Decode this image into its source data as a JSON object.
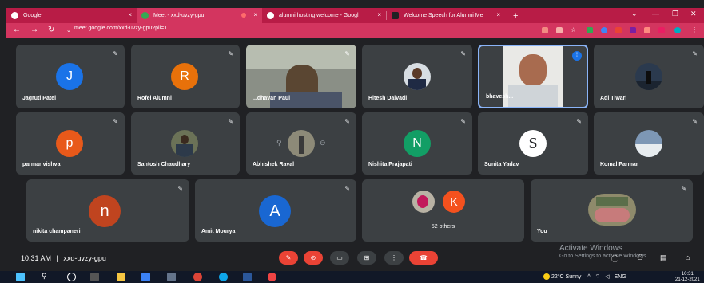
{
  "browser": {
    "tabs": [
      {
        "title": "Google",
        "x": "×"
      },
      {
        "title": "Meet - xxd-uvzy-gpu",
        "x": "×"
      },
      {
        "title": "alumni hosting welcome - Googl",
        "x": "×"
      },
      {
        "title": "Welcome Speech for Alumni Me",
        "x": "×"
      }
    ],
    "new_tab": "+",
    "url": "meet.google.com/xxd-uvzy-gpu?pli=1",
    "colors": {
      "tab_bar": "#b81c46",
      "active_tab": "#d3355f"
    }
  },
  "participants": [
    {
      "name": "Jagruti Patel",
      "initial": "J",
      "color": "#1a73e8"
    },
    {
      "name": "Rofel Alumni",
      "initial": "R",
      "color": "#e8710a"
    },
    {
      "name": "...dhavan Paul"
    },
    {
      "name": "Hitesh Dalvadi"
    },
    {
      "name": "bhavesh..."
    },
    {
      "name": "Adi Tiwari"
    },
    {
      "name": "parmar vishva",
      "initial": "p",
      "color": "#e8591a"
    },
    {
      "name": "Santosh Chaudhary"
    },
    {
      "name": "Abhishek Raval"
    },
    {
      "name": "Nishita Prajapati",
      "initial": "N",
      "color": "#129e65"
    },
    {
      "name": "Sunita Yadav",
      "initial": "S",
      "color": "#ffffff"
    },
    {
      "name": "Komal Parmar"
    },
    {
      "name": "nikita champaneri",
      "initial": "n",
      "color": "#c0441f"
    },
    {
      "name": "Amit Mourya",
      "initial": "A",
      "color": "#1967d2"
    },
    {
      "name": "52 others",
      "initial": "K",
      "color": "#f4511e"
    },
    {
      "name": "You"
    }
  ],
  "meeting": {
    "time": "10:31 AM",
    "separator": "|",
    "code": "xxd-uvzy-gpu"
  },
  "controls": [
    "mic-off-icon",
    "camera-off-icon",
    "captions-icon",
    "present-icon",
    "more-icon",
    "end-call-icon"
  ],
  "activate": {
    "line1": "Activate Windows",
    "line2": "Go to Settings to activate Windows."
  },
  "taskbar": {
    "weather": "22°C Sunny",
    "lang": "ENG",
    "time": "10:31",
    "date": "21-12-2021"
  }
}
